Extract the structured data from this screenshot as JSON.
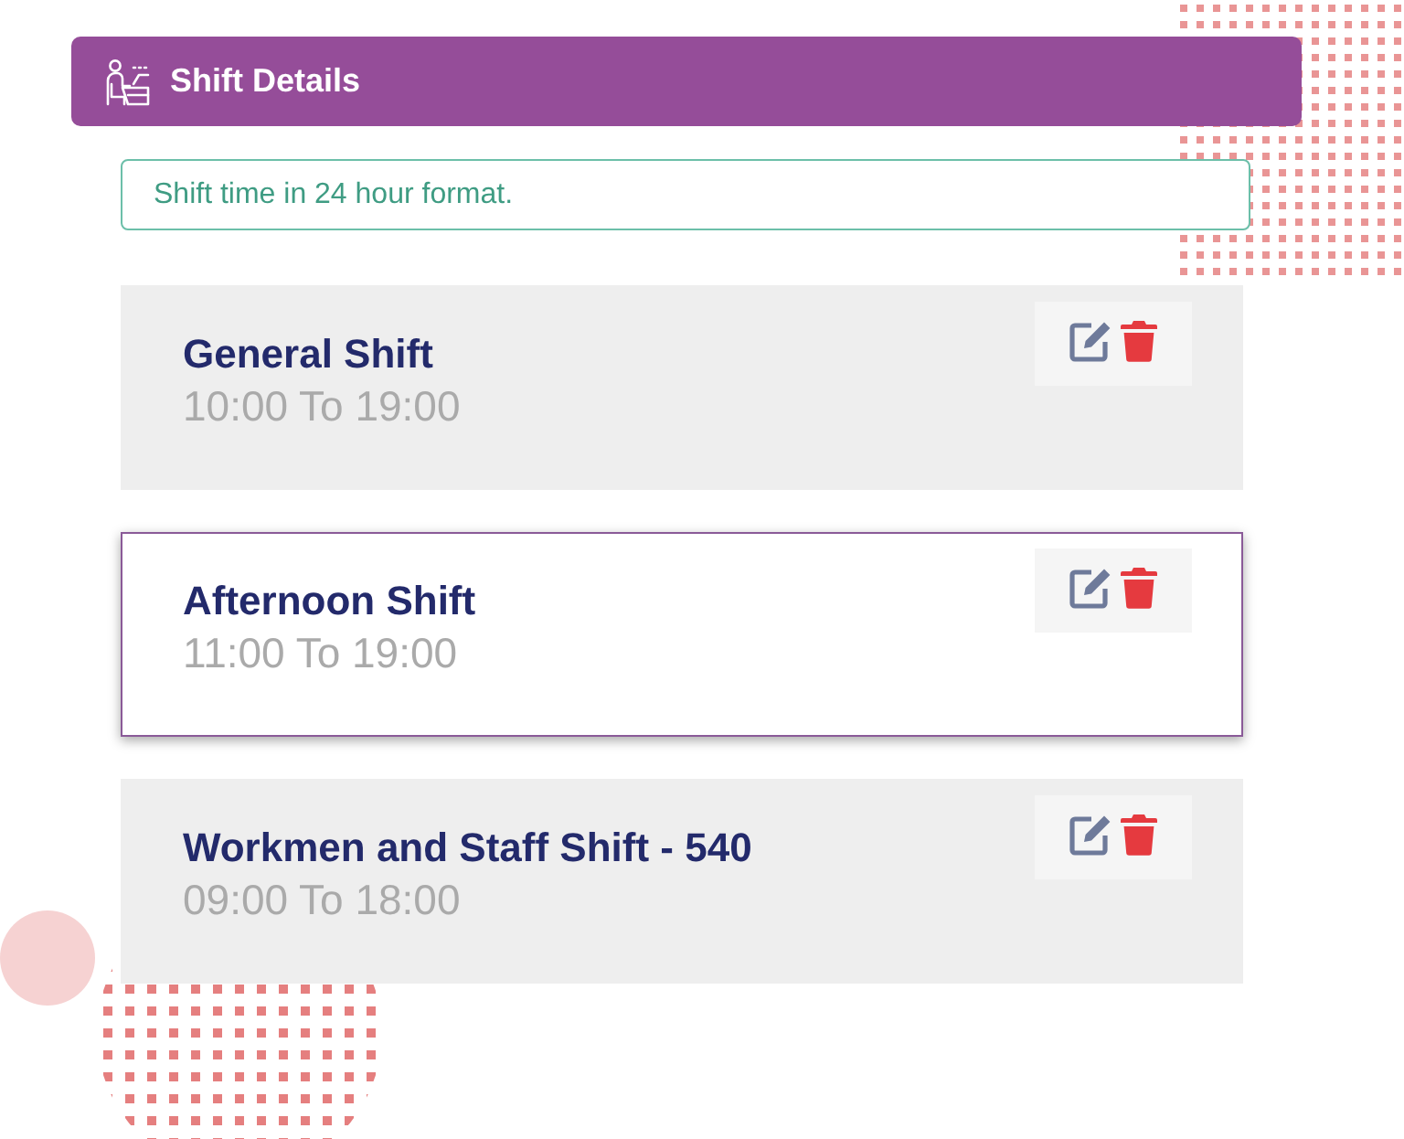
{
  "header": {
    "title": "Shift Details"
  },
  "notice": {
    "text": "Shift time in 24 hour format."
  },
  "shifts": [
    {
      "name": "General Shift",
      "time": "10:00 To 19:00",
      "selected": false
    },
    {
      "name": "Afternoon Shift",
      "time": "11:00 To 19:00",
      "selected": true
    },
    {
      "name": "Workmen and Staff Shift - 540",
      "time": "09:00 To 18:00",
      "selected": false
    }
  ]
}
